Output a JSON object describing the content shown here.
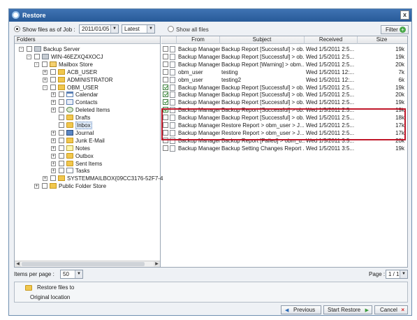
{
  "window": {
    "title": "Restore",
    "close_symbol": "x"
  },
  "toolbar": {
    "show_as_of_label": "Show files as of Job :",
    "job_date": "2011/01/05",
    "version": "Latest",
    "show_all_label": "Show all files",
    "filter_label": "Filter",
    "filter_icon": "+"
  },
  "folders": {
    "header": "Folders",
    "tree": [
      {
        "label": "Backup Server",
        "icon": "server-icon",
        "expander": "-",
        "checked": false
      },
      {
        "label": "WIN-46EZXQ4XOCJ",
        "icon": "server-icon",
        "expander": "-",
        "checked": false
      },
      {
        "label": "Mailbox Store",
        "icon": "store-icon",
        "expander": "-",
        "checked": false
      },
      {
        "label": "ACB_USER",
        "icon": "user-icon",
        "expander": "+",
        "checked": false
      },
      {
        "label": "ADMINISTRATOR",
        "icon": "user-icon",
        "expander": "+",
        "checked": false
      },
      {
        "label": "OBM_USER",
        "icon": "user-icon",
        "expander": "-",
        "checked": false
      },
      {
        "label": "Calendar",
        "icon": "calendar-icon",
        "expander": "+",
        "checked": false
      },
      {
        "label": "Contacts",
        "icon": "contacts-icon",
        "expander": "+",
        "checked": false
      },
      {
        "label": "Deleted Items",
        "icon": "deleted-items-icon",
        "expander": "+",
        "checked": false
      },
      {
        "label": "Drafts",
        "icon": "folder-icon",
        "expander": "",
        "checked": false
      },
      {
        "label": "Inbox",
        "icon": "folder-icon",
        "expander": "",
        "checked": false
      },
      {
        "label": "Journal",
        "icon": "journal-icon",
        "expander": "+",
        "checked": false
      },
      {
        "label": "Junk E-Mail",
        "icon": "junk-folder-icon",
        "expander": "+",
        "checked": false
      },
      {
        "label": "Notes",
        "icon": "notes-icon",
        "expander": "+",
        "checked": false
      },
      {
        "label": "Outbox",
        "icon": "folder-icon",
        "expander": "+",
        "checked": false
      },
      {
        "label": "Sent Items",
        "icon": "folder-icon",
        "expander": "+",
        "checked": false
      },
      {
        "label": "Tasks",
        "icon": "tasks-icon",
        "expander": "+",
        "checked": false
      },
      {
        "label": "SYSTEMMAILBOX{09CC3176-52F7-4",
        "icon": "user-icon",
        "expander": "+",
        "checked": false
      },
      {
        "label": "Public Folder Store",
        "icon": "public-folder-icon",
        "expander": "+",
        "checked": false
      }
    ]
  },
  "messages": {
    "columns": [
      "From",
      "Subject",
      "Received",
      "Size"
    ],
    "rows": [
      {
        "from": "Backup Manager",
        "subject": "Backup Report [Successful] > ob...",
        "received": "Wed 1/5/2011 2:5...",
        "size": "19k",
        "checked": false
      },
      {
        "from": "Backup Manager",
        "subject": "Backup Report [Successful] > ob...",
        "received": "Wed 1/5/2011 2:5...",
        "size": "19k",
        "checked": false
      },
      {
        "from": "Backup Manager",
        "subject": "Backup Report [Warning] > obm...",
        "received": "Wed 1/5/2011 2:5...",
        "size": "20k",
        "checked": false
      },
      {
        "from": "obm_user",
        "subject": "testing",
        "received": "Wed 1/5/2011 12:...",
        "size": "7k",
        "checked": false
      },
      {
        "from": "obm_user",
        "subject": "testing2",
        "received": "Wed 1/5/2011 12:...",
        "size": "6k",
        "checked": false
      },
      {
        "from": "Backup Manager",
        "subject": "Backup Report [Successful] > ob...",
        "received": "Wed 1/5/2011 2:5...",
        "size": "19k",
        "checked": true
      },
      {
        "from": "Backup Manager",
        "subject": "Backup Report [Successful] > ob...",
        "received": "Wed 1/5/2011 2:5...",
        "size": "20k",
        "checked": true
      },
      {
        "from": "Backup Manager",
        "subject": "Backup Report [Successful] > ob...",
        "received": "Wed 1/5/2011 2:5...",
        "size": "19k",
        "checked": true
      },
      {
        "from": "Backup Manager",
        "subject": "Backup Report [Successful] > ob...",
        "received": "Wed 1/5/2011 2:5...",
        "size": "19k",
        "checked": true
      },
      {
        "from": "Backup Manager",
        "subject": "Backup Report [Successful] > ob...",
        "received": "Wed 1/5/2011 2:5...",
        "size": "18k",
        "checked": false
      },
      {
        "from": "Backup Manager",
        "subject": "Restore Report > obm_user > J...",
        "received": "Wed 1/5/2011 2:5...",
        "size": "17k",
        "checked": false
      },
      {
        "from": "Backup Manager",
        "subject": "Restore Report > obm_user > J...",
        "received": "Wed 1/5/2011 2:5...",
        "size": "17k",
        "checked": false
      },
      {
        "from": "Backup Manager",
        "subject": "Backup Report [Failed] > obm_u...",
        "received": "Wed 1/5/2011 3:5...",
        "size": "20k",
        "checked": false
      },
      {
        "from": "Backup Manager",
        "subject": "Backup Setting Changes Report ...",
        "received": "Wed 1/5/2011 3:5...",
        "size": "19k",
        "checked": false
      }
    ]
  },
  "pagination": {
    "items_per_page_label": "Items per page :",
    "items_per_page": "50",
    "page_label": "Page :",
    "page_value": "1 / 1"
  },
  "restore": {
    "restore_to_label": "Restore files to",
    "location": "Original location"
  },
  "footer": {
    "previous_label": "Previous",
    "start_restore_label": "Start Restore",
    "cancel_label": "Cancel"
  },
  "colors": {
    "title_bar": "#2f64a6",
    "highlight_border": "#c0172a",
    "check_green": "#2a8a2a"
  }
}
